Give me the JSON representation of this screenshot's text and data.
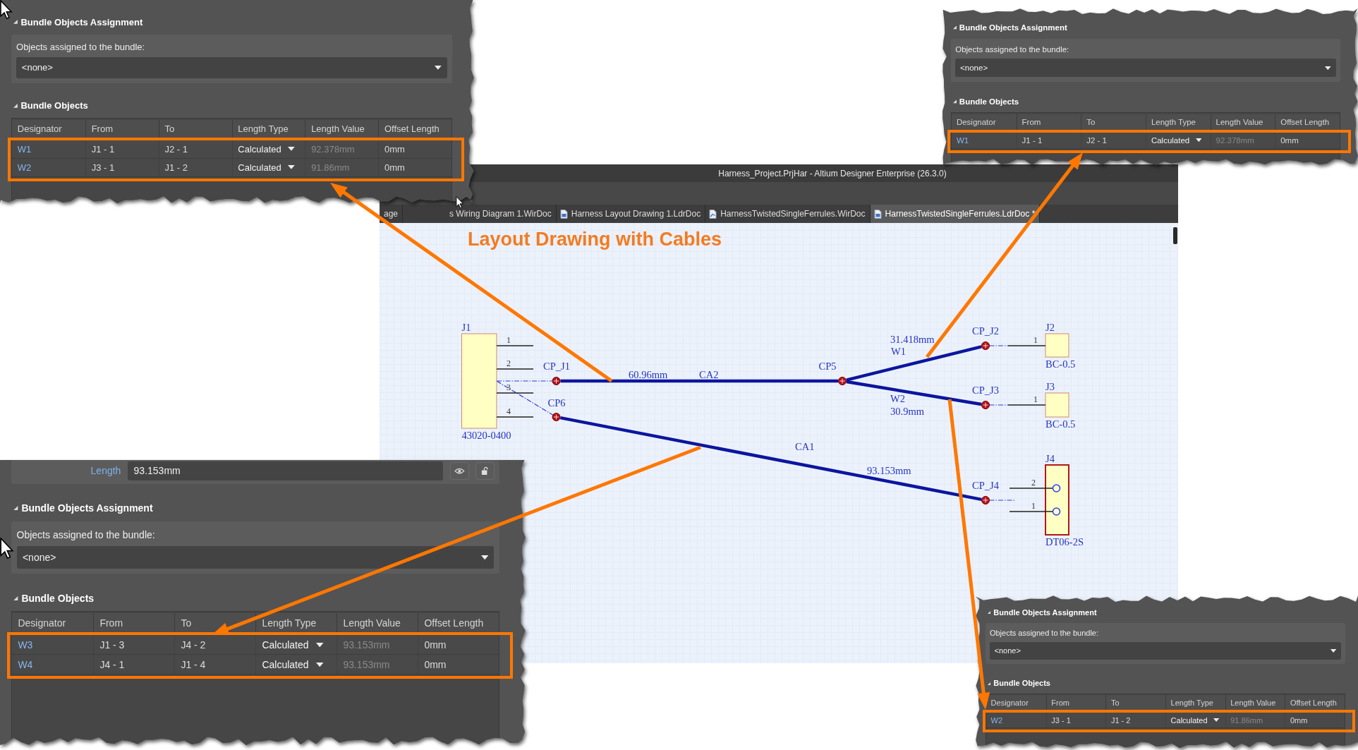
{
  "window": {
    "title": "Harness_Project.PrjHar - Altium Designer Enterprise (26.3.0)"
  },
  "tabs": [
    {
      "label": "age",
      "kind": "cut",
      "selected": false
    },
    {
      "label": "s Wiring Diagram 1.WirDoc",
      "kind": "cut",
      "selected": false
    },
    {
      "label": "Harness Layout Drawing 1.LdrDoc",
      "kind": "layout",
      "selected": false
    },
    {
      "label": "HarnessTwistedSingleFerrules.WirDoc",
      "kind": "wiring",
      "selected": false
    },
    {
      "label": "HarnessTwistedSingleFerrules.LdrDoc *",
      "kind": "layout",
      "selected": true
    }
  ],
  "drawing": {
    "title": "Layout Drawing with Cables",
    "connectors": [
      {
        "designator": "J1",
        "part": "43020-0400",
        "kind": "header",
        "pins": [
          "1",
          "2",
          "3",
          "4"
        ]
      },
      {
        "designator": "J2",
        "part": "BC-0.5",
        "kind": "ferrule",
        "pins": [
          "1"
        ]
      },
      {
        "designator": "J3",
        "part": "BC-0.5",
        "kind": "ferrule",
        "pins": [
          "1"
        ]
      },
      {
        "designator": "J4",
        "part": "DT06-2S",
        "kind": "plug",
        "pins": [
          "2",
          "1"
        ]
      }
    ],
    "points": [
      {
        "label": "CP_J1"
      },
      {
        "label": "CP6"
      },
      {
        "label": "CP5"
      },
      {
        "label": "CP_J2"
      },
      {
        "label": "CP_J3"
      },
      {
        "label": "CP_J4"
      }
    ],
    "segments": [
      {
        "name": "CA2",
        "length": "60.96mm"
      },
      {
        "name": "W1",
        "length": "31.418mm"
      },
      {
        "name": "W2",
        "length": "30.9mm"
      },
      {
        "name": "CA1",
        "length": "93.153mm"
      }
    ]
  },
  "callouts": [
    {
      "assignment": {
        "title": "Bundle Objects Assignment",
        "expanded": true,
        "label": "Objects assigned to the bundle:",
        "value": "<none>"
      },
      "objects": {
        "title": "Bundle Objects",
        "expanded": true,
        "highlighted": true,
        "columns": [
          {
            "label": "Designator",
            "kind": "link"
          },
          {
            "label": "From",
            "kind": "text"
          },
          {
            "label": "To",
            "kind": "text"
          },
          {
            "label": "Length Type",
            "kind": "dropdown"
          },
          {
            "label": "Length Value",
            "kind": "readonly"
          },
          {
            "label": "Offset Length",
            "kind": "text"
          }
        ],
        "rows": [
          [
            "W1",
            "J1 - 1",
            "J2 - 1",
            "Calculated",
            "92.378mm",
            "0mm"
          ],
          [
            "W2",
            "J3 - 1",
            "J1 - 2",
            "Calculated",
            "91.86mm",
            "0mm"
          ]
        ]
      }
    },
    {
      "assignment": {
        "title": "Bundle Objects Assignment",
        "expanded": true,
        "label": "Objects assigned to the bundle:",
        "value": "<none>"
      },
      "objects": {
        "title": "Bundle Objects",
        "expanded": true,
        "highlighted": true,
        "columns": [
          {
            "label": "Designator",
            "kind": "link"
          },
          {
            "label": "From",
            "kind": "text"
          },
          {
            "label": "To",
            "kind": "text"
          },
          {
            "label": "Length Type",
            "kind": "dropdown"
          },
          {
            "label": "Length Value",
            "kind": "readonly"
          },
          {
            "label": "Offset Length",
            "kind": "text"
          }
        ],
        "rows": [
          [
            "W1",
            "J1 - 1",
            "J2 - 1",
            "Calculated",
            "92.378mm",
            "0mm"
          ]
        ]
      }
    },
    {
      "length": {
        "label": "Length",
        "value": "93.153mm"
      },
      "assignment": {
        "title": "Bundle Objects Assignment",
        "expanded": true,
        "label": "Objects assigned to the bundle:",
        "value": "<none>"
      },
      "objects": {
        "title": "Bundle Objects",
        "expanded": true,
        "highlighted": true,
        "columns": [
          {
            "label": "Designator",
            "kind": "link"
          },
          {
            "label": "From",
            "kind": "text"
          },
          {
            "label": "To",
            "kind": "text"
          },
          {
            "label": "Length Type",
            "kind": "dropdown"
          },
          {
            "label": "Length Value",
            "kind": "readonly"
          },
          {
            "label": "Offset Length",
            "kind": "text"
          }
        ],
        "rows": [
          [
            "W3",
            "J1 - 3",
            "J4 - 2",
            "Calculated",
            "93.153mm",
            "0mm"
          ],
          [
            "W4",
            "J4 - 1",
            "J1 - 4",
            "Calculated",
            "93.153mm",
            "0mm"
          ]
        ]
      }
    },
    {
      "assignment": {
        "title": "Bundle Objects Assignment",
        "expanded": true,
        "label": "Objects assigned to the bundle:",
        "value": "<none>"
      },
      "objects": {
        "title": "Bundle Objects",
        "expanded": true,
        "highlighted": true,
        "columns": [
          {
            "label": "Designator",
            "kind": "link"
          },
          {
            "label": "From",
            "kind": "text"
          },
          {
            "label": "To",
            "kind": "text"
          },
          {
            "label": "Length Type",
            "kind": "dropdown"
          },
          {
            "label": "Length Value",
            "kind": "readonly"
          },
          {
            "label": "Offset Length",
            "kind": "text"
          }
        ],
        "rows": [
          [
            "W2",
            "J3 - 1",
            "J1 - 2",
            "Calculated",
            "91.86mm",
            "0mm"
          ]
        ]
      }
    }
  ]
}
